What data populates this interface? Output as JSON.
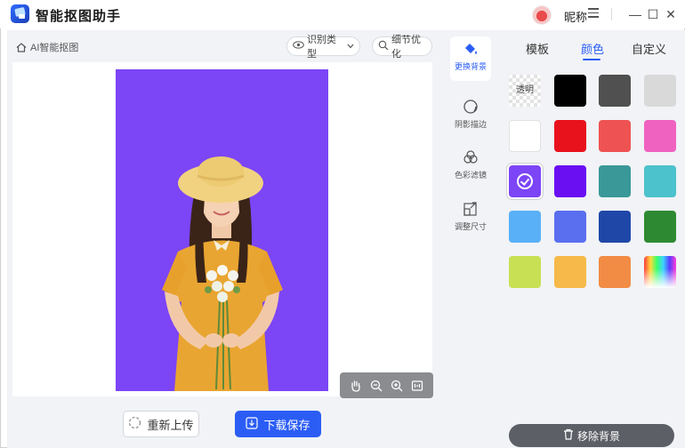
{
  "window": {
    "title": "智能抠图助手",
    "nickname": "昵称",
    "controls": {
      "minimize": "—",
      "maximize": "☐",
      "close": "✕"
    }
  },
  "canvas": {
    "breadcrumb": "AI智能抠图",
    "recognize_type_label": "识别类型",
    "detail_optimize_label": "细节优化",
    "background_color": "#7c45f6",
    "zoom_tools": [
      "hand-icon",
      "zoom-out-icon",
      "zoom-in-icon",
      "fit-icon"
    ]
  },
  "actions": {
    "reupload_label": "重新上传",
    "download_label": "下载保存"
  },
  "tools": [
    {
      "label": "更换背景",
      "icon": "paint-bucket-icon",
      "active": true
    },
    {
      "label": "阴影描边",
      "icon": "shadow-circle-icon",
      "active": false
    },
    {
      "label": "色彩滤镜",
      "icon": "color-filter-icon",
      "active": false
    },
    {
      "label": "调整尺寸",
      "icon": "resize-icon",
      "active": false
    }
  ],
  "panel": {
    "tabs": [
      {
        "label": "模板",
        "active": false
      },
      {
        "label": "颜色",
        "active": true
      },
      {
        "label": "自定义",
        "active": false
      }
    ],
    "transparent_label": "透明",
    "colors": [
      "transparent",
      "#000000",
      "#505050",
      "#d9d9d9",
      "#ffffff",
      "#e8121d",
      "#ef5252",
      "#f062c0",
      "#7c45f6",
      "#6a0ff2",
      "#3a9898",
      "#4cc2cc",
      "#59b0f7",
      "#5a6ef0",
      "#1f47a8",
      "#2e8a32",
      "#c8e054",
      "#f6b94a",
      "#f28c44",
      "rainbow"
    ],
    "selected_color": "#7c45f6",
    "remove_bg_label": "移除背景"
  }
}
